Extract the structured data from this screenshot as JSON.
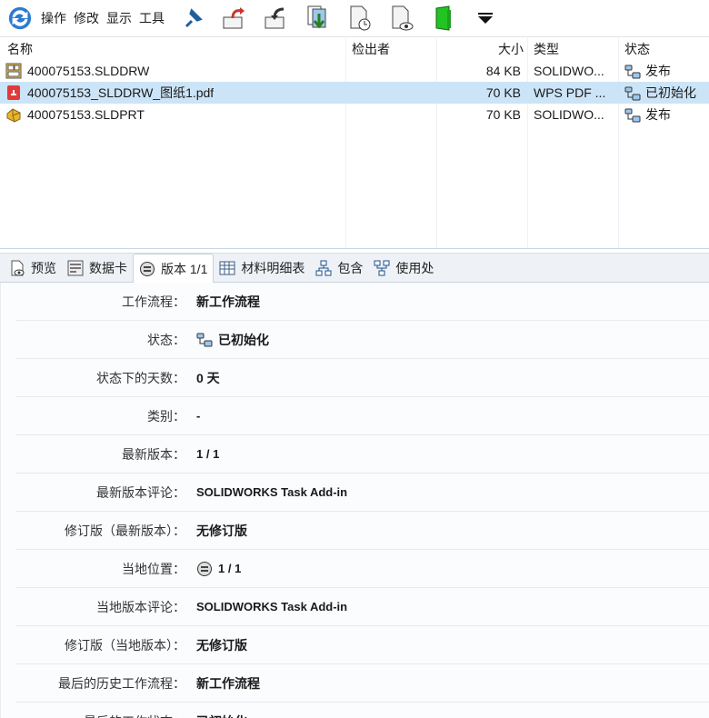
{
  "toolbar": {
    "menus": [
      "操作",
      "修改",
      "显示",
      "工具"
    ],
    "icons": [
      "refresh-icon",
      "pin-icon",
      "check-out-icon",
      "check-in-icon",
      "get-latest-icon",
      "get-version-icon",
      "view-file-icon",
      "open-folder-icon",
      "dropdown-arrow-icon"
    ]
  },
  "list": {
    "columns": {
      "name": "名称",
      "checked_out_by": "检出者",
      "size": "大小",
      "type": "类型",
      "state": "状态"
    },
    "rows": [
      {
        "name": "400075153.SLDDRW",
        "checked_out_by": "",
        "size": "84 KB",
        "type": "SOLIDWO...",
        "state": "发布",
        "icon": "drawing-icon"
      },
      {
        "name": "400075153_SLDDRW_图纸1.pdf",
        "checked_out_by": "",
        "size": "70 KB",
        "type": "WPS PDF ...",
        "state": "已初始化",
        "icon": "pdf-icon",
        "selected": true
      },
      {
        "name": "400075153.SLDPRT",
        "checked_out_by": "",
        "size": "70 KB",
        "type": "SOLIDWO...",
        "state": "发布",
        "icon": "part-icon"
      }
    ]
  },
  "tabs": [
    {
      "label": "预览"
    },
    {
      "label": "数据卡"
    },
    {
      "label": "版本 1/1",
      "active": true
    },
    {
      "label": "材料明细表"
    },
    {
      "label": "包含"
    },
    {
      "label": "使用处"
    }
  ],
  "details": [
    {
      "label": "工作流程：",
      "value": "新工作流程"
    },
    {
      "label": "状态：",
      "value": "已初始化"
    },
    {
      "label": "状态下的天数：",
      "value": "0 天"
    },
    {
      "label": "类别：",
      "value": "-"
    },
    {
      "label": "最新版本：",
      "value": "1 / 1"
    },
    {
      "label": "最新版本评论：",
      "value": "SOLIDWORKS Task Add-in"
    },
    {
      "label": "修订版（最新版本）：",
      "value": "无修订版"
    },
    {
      "label": "当地位置：",
      "value": "1 / 1"
    },
    {
      "label": "当地版本评论：",
      "value": "SOLIDWORKS Task Add-in"
    },
    {
      "label": "修订版（当地版本）：",
      "value": "无修订版"
    },
    {
      "label": "最后的历史工作流程：",
      "value": "新工作流程"
    },
    {
      "label": "最后的工作状态：",
      "value": "已初始化"
    }
  ]
}
